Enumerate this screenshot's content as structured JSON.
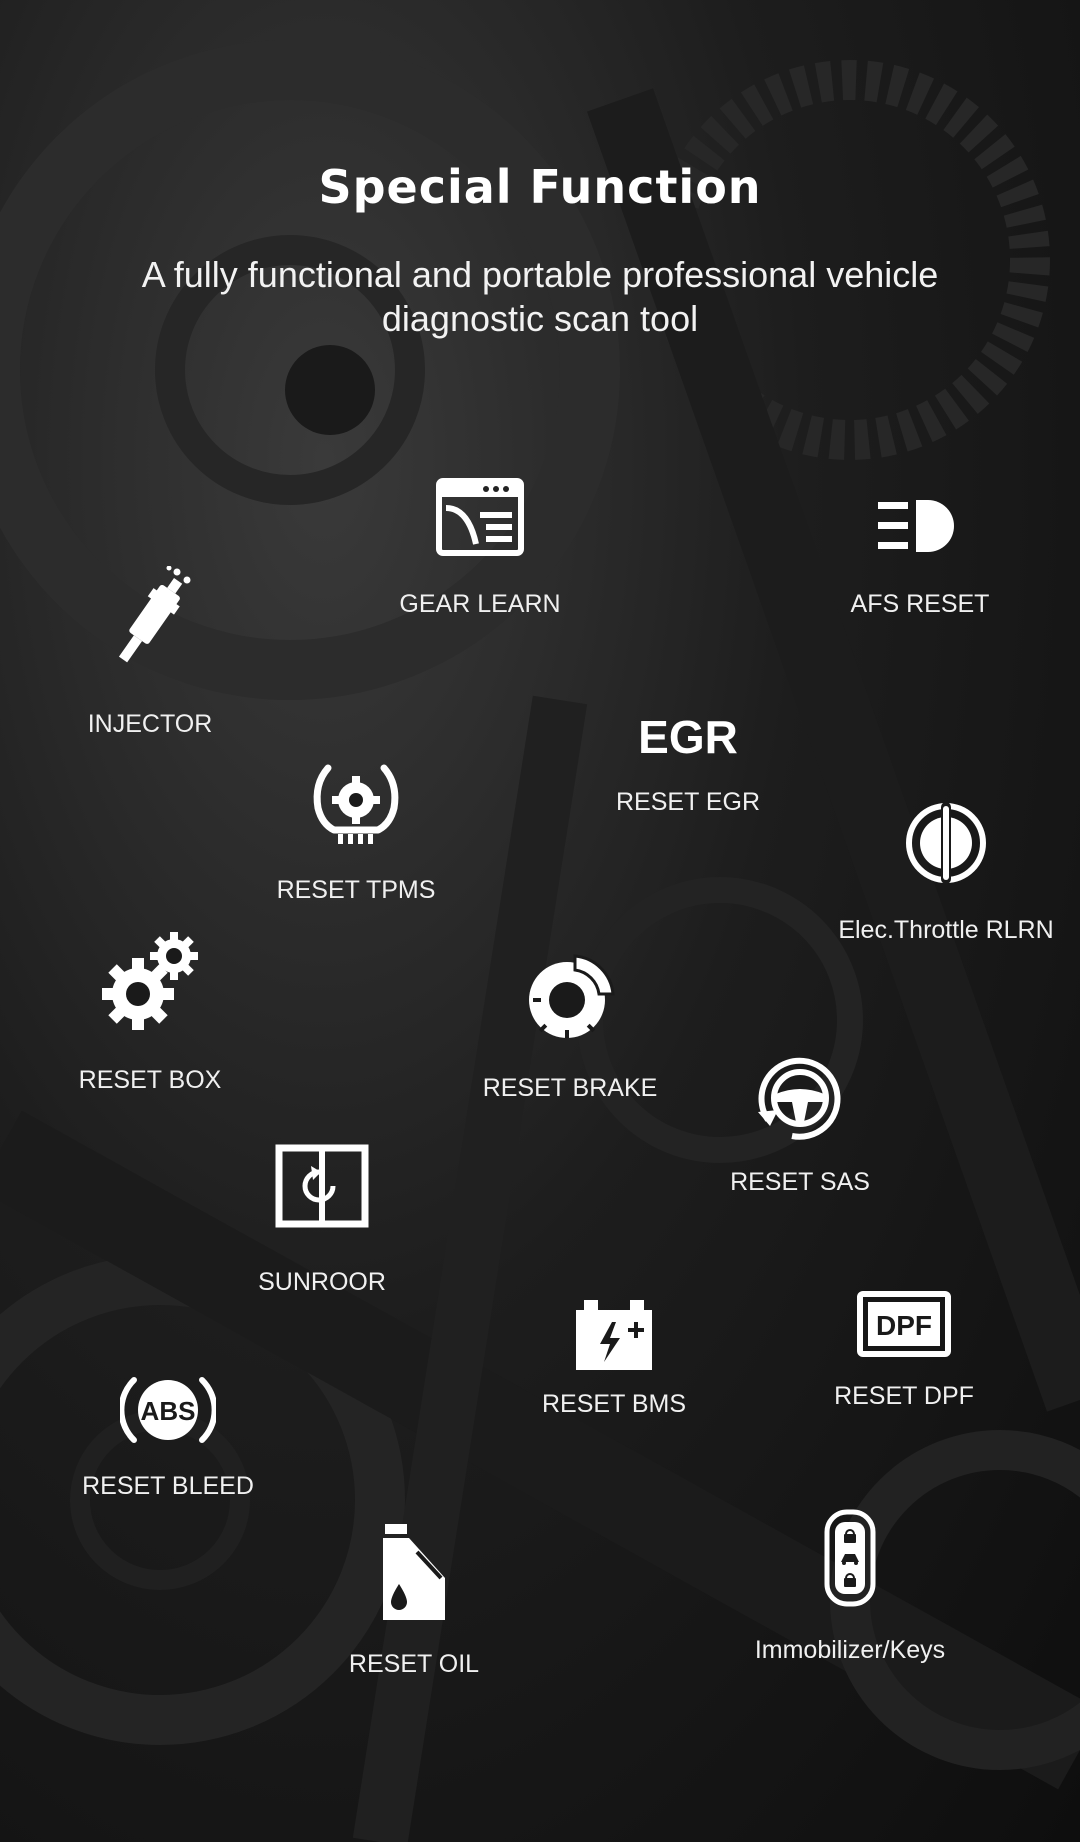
{
  "title": "Special Function",
  "subtitle": "A fully functional and portable professional vehicle diagnostic scan tool",
  "functions": [
    {
      "label": "GEAR LEARN",
      "icon": "gear-learn-icon"
    },
    {
      "label": "AFS RESET",
      "icon": "headlight-icon"
    },
    {
      "label": "INJECTOR",
      "icon": "injector-icon"
    },
    {
      "label": "RESET EGR",
      "icon": "egr-icon",
      "icon_text": "EGR"
    },
    {
      "label": "RESET TPMS",
      "icon": "tpms-icon"
    },
    {
      "label": "Elec.Throttle RLRN",
      "icon": "throttle-icon"
    },
    {
      "label": "RESET BOX",
      "icon": "gears-icon"
    },
    {
      "label": "RESET BRAKE",
      "icon": "brake-disc-icon"
    },
    {
      "label": "RESET SAS",
      "icon": "steering-wheel-icon"
    },
    {
      "label": "SUNROOR",
      "icon": "sunroof-icon"
    },
    {
      "label": "RESET BMS",
      "icon": "battery-icon"
    },
    {
      "label": "RESET DPF",
      "icon": "dpf-icon",
      "icon_text": "DPF"
    },
    {
      "label": "RESET BLEED",
      "icon": "abs-icon",
      "icon_text": "ABS"
    },
    {
      "label": "RESET OIL",
      "icon": "oil-can-icon"
    },
    {
      "label": "Immobilizer/Keys",
      "icon": "car-key-icon"
    }
  ]
}
